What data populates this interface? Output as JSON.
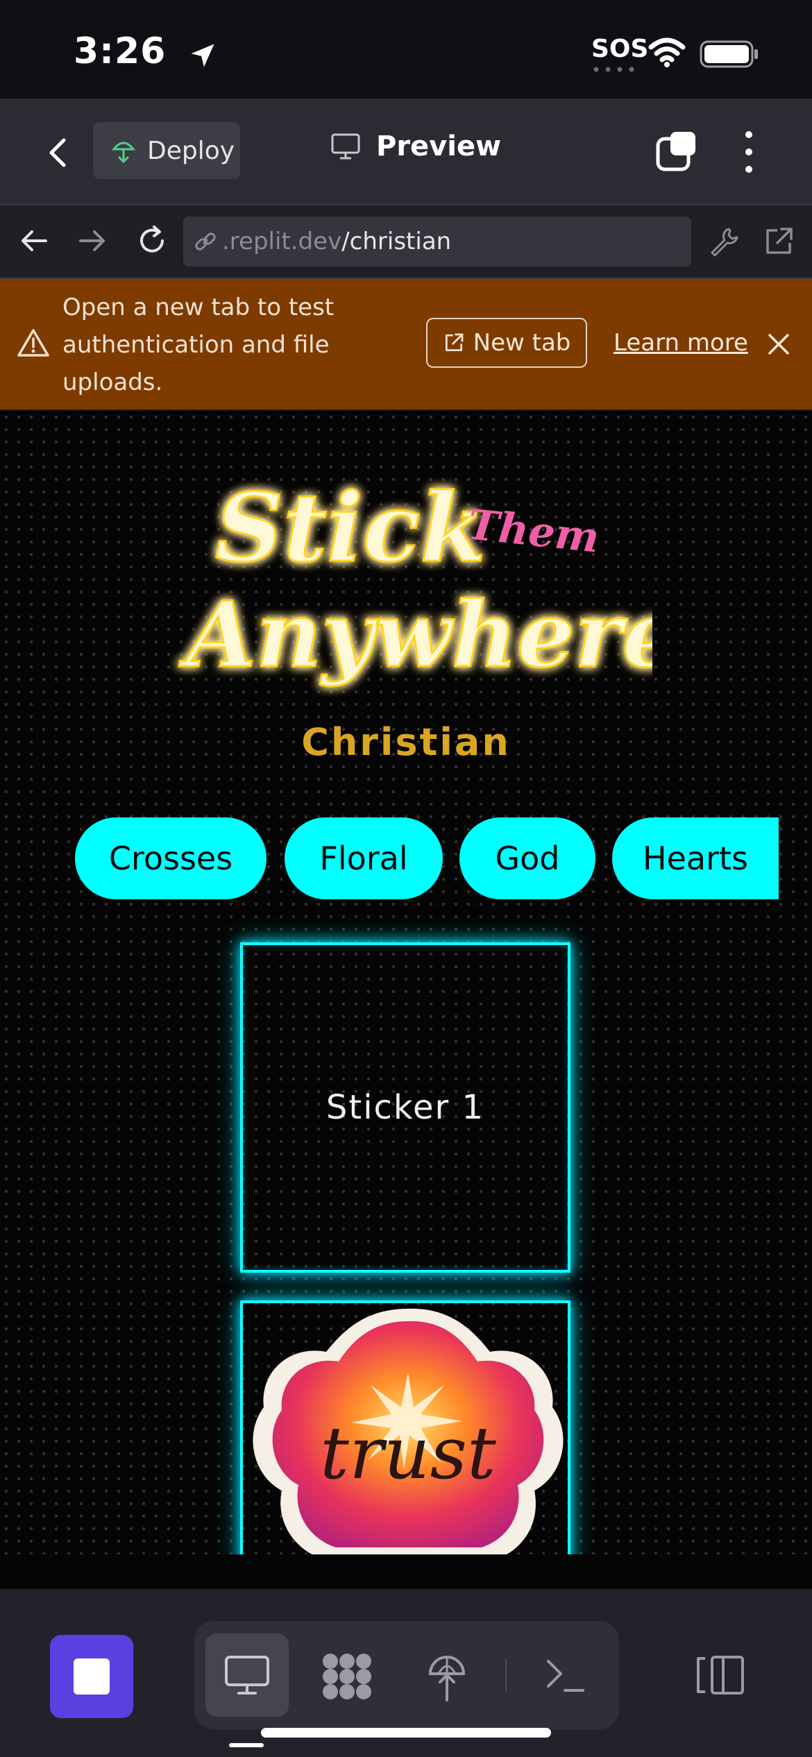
{
  "status_bar": {
    "time": "3:26",
    "sos": "SOS"
  },
  "toolbar": {
    "deploy_label": "Deploy",
    "preview_label": "Preview"
  },
  "address": {
    "host": ".replit.dev",
    "path": "/christian"
  },
  "banner": {
    "message": "Open a new tab to test authentication and file uploads.",
    "new_tab_label": "New tab",
    "learn_more_label": "Learn more"
  },
  "app": {
    "logo_line1": "Stick",
    "logo_them": "Them",
    "logo_line2": "Anywhere",
    "subtitle": "Christian",
    "categories": [
      "Crosses",
      "Floral",
      "God",
      "Hearts"
    ],
    "stickers": [
      {
        "label": "Sticker 1"
      },
      {
        "art_text": "trust"
      }
    ]
  },
  "colors": {
    "accent_cyan": "#00ffff",
    "neon_yellow": "#fff2a8",
    "neon_pink": "#ef5fa8",
    "subtitle_gold": "#d9a624",
    "banner_bg": "#7d3b00",
    "stop_button": "#5b3fe0"
  },
  "icons": {
    "location": "location-arrow-icon",
    "wifi": "wifi-icon",
    "battery": "battery-icon",
    "back": "chevron-left-icon",
    "tabs": "tabs-icon",
    "menu": "more-vertical-icon",
    "reload": "reload-icon",
    "wrench": "wrench-icon",
    "external": "external-link-icon",
    "warning": "warning-icon",
    "close": "close-icon"
  }
}
